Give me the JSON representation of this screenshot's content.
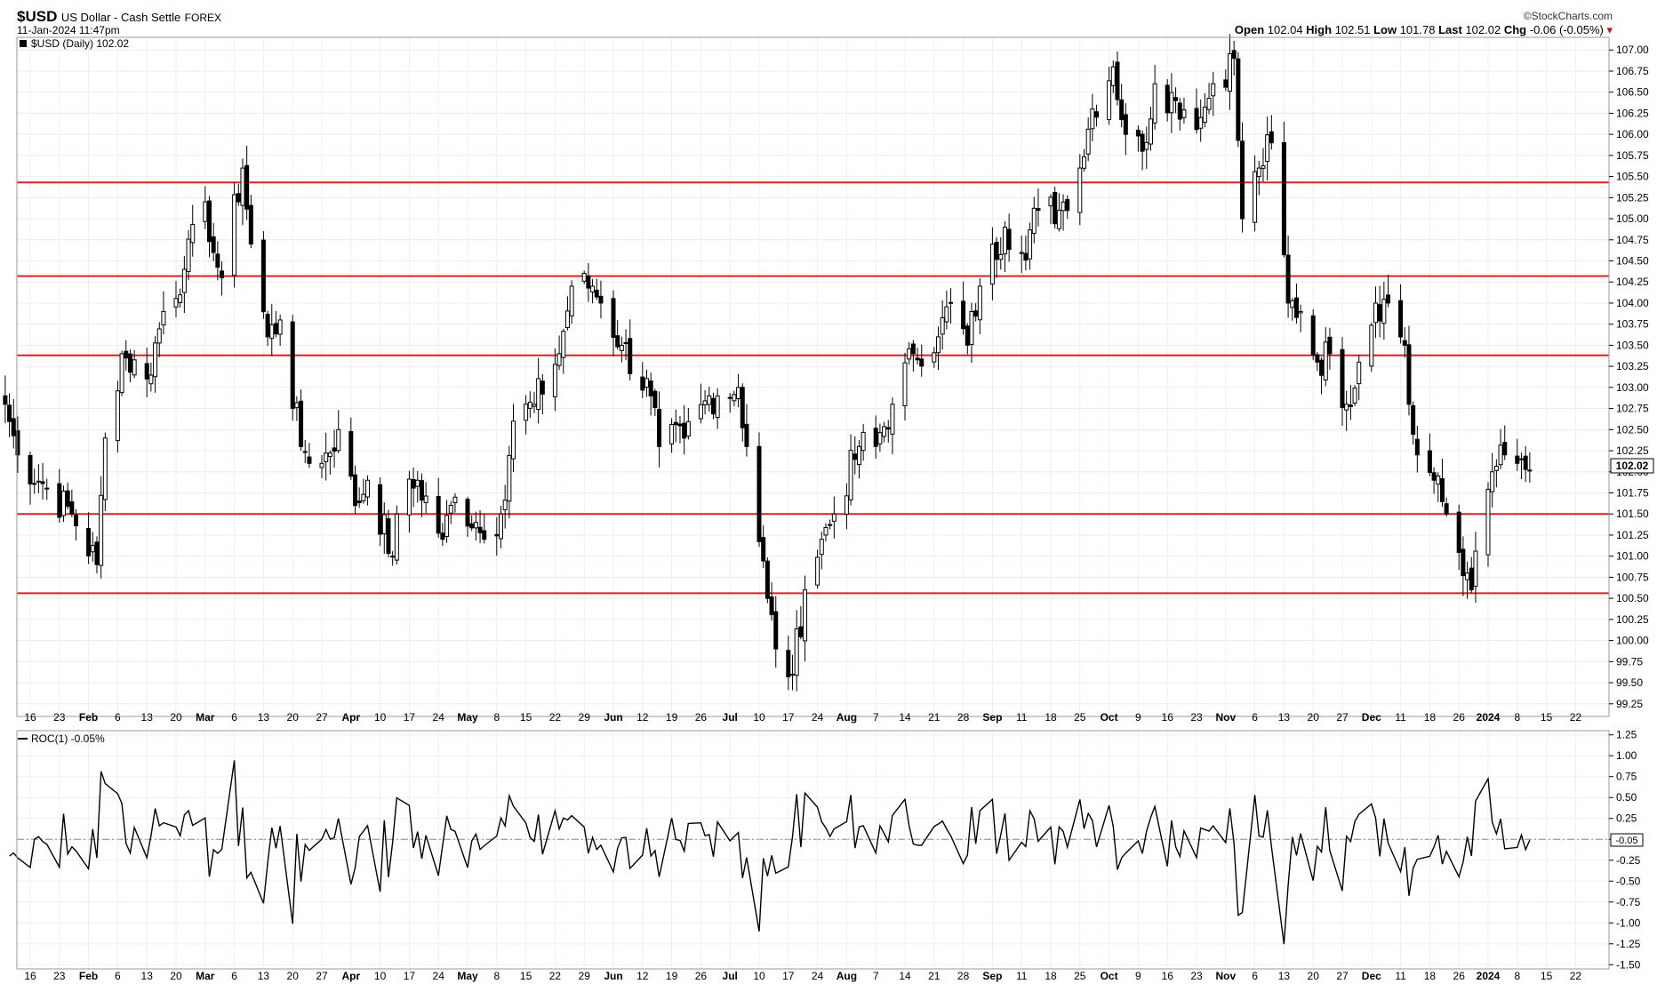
{
  "header": {
    "symbol": "$USD",
    "name": "US Dollar - Cash Settle",
    "exchange": "FOREX",
    "datetime": "11-Jan-2024 11:47pm",
    "brand": "©StockCharts.com",
    "open_label": "Open",
    "open": "102.04",
    "high_label": "High",
    "high": "102.51",
    "low_label": "Low",
    "low": "101.78",
    "last_label": "Last",
    "last": "102.02",
    "chg_label": "Chg",
    "chg": "-0.06 (-0.05%)"
  },
  "colors": {
    "resistance_line": "#e02020",
    "support_line": "#1a8a1a",
    "candle": "#000000",
    "roc_line": "#000000"
  },
  "chart_data": [
    {
      "type": "candlestick",
      "title": "$USD (Daily) 102.02",
      "last_value_label": "102.02",
      "ylim": [
        99.1,
        107.15
      ],
      "y_ticks": [
        "107.00",
        "106.75",
        "106.50",
        "106.25",
        "106.00",
        "105.75",
        "105.50",
        "105.25",
        "105.00",
        "104.75",
        "104.50",
        "104.25",
        "104.00",
        "103.75",
        "103.50",
        "103.25",
        "103.00",
        "102.75",
        "102.50",
        "102.25",
        "102.00",
        "101.75",
        "101.50",
        "101.25",
        "101.00",
        "100.75",
        "100.50",
        "100.25",
        "100.00",
        "99.75",
        "99.50",
        "99.25"
      ],
      "x_ticks": [
        {
          "label": "16",
          "bold": false
        },
        {
          "label": "23",
          "bold": false
        },
        {
          "label": "Feb",
          "bold": true
        },
        {
          "label": "6",
          "bold": false
        },
        {
          "label": "13",
          "bold": false
        },
        {
          "label": "20",
          "bold": false
        },
        {
          "label": "Mar",
          "bold": true
        },
        {
          "label": "6",
          "bold": false
        },
        {
          "label": "13",
          "bold": false
        },
        {
          "label": "20",
          "bold": false
        },
        {
          "label": "27",
          "bold": false
        },
        {
          "label": "Apr",
          "bold": true
        },
        {
          "label": "10",
          "bold": false
        },
        {
          "label": "17",
          "bold": false
        },
        {
          "label": "24",
          "bold": false
        },
        {
          "label": "May",
          "bold": true
        },
        {
          "label": "8",
          "bold": false
        },
        {
          "label": "15",
          "bold": false
        },
        {
          "label": "22",
          "bold": false
        },
        {
          "label": "29",
          "bold": false
        },
        {
          "label": "Jun",
          "bold": true
        },
        {
          "label": "12",
          "bold": false
        },
        {
          "label": "19",
          "bold": false
        },
        {
          "label": "26",
          "bold": false
        },
        {
          "label": "Jul",
          "bold": true
        },
        {
          "label": "10",
          "bold": false
        },
        {
          "label": "17",
          "bold": false
        },
        {
          "label": "24",
          "bold": false
        },
        {
          "label": "Aug",
          "bold": true
        },
        {
          "label": "7",
          "bold": false
        },
        {
          "label": "14",
          "bold": false
        },
        {
          "label": "21",
          "bold": false
        },
        {
          "label": "28",
          "bold": false
        },
        {
          "label": "Sep",
          "bold": true
        },
        {
          "label": "11",
          "bold": false
        },
        {
          "label": "18",
          "bold": false
        },
        {
          "label": "25",
          "bold": false
        },
        {
          "label": "Oct",
          "bold": true
        },
        {
          "label": "9",
          "bold": false
        },
        {
          "label": "16",
          "bold": false
        },
        {
          "label": "23",
          "bold": false
        },
        {
          "label": "Nov",
          "bold": true
        },
        {
          "label": "6",
          "bold": false
        },
        {
          "label": "13",
          "bold": false
        },
        {
          "label": "20",
          "bold": false
        },
        {
          "label": "27",
          "bold": false
        },
        {
          "label": "Dec",
          "bold": true
        },
        {
          "label": "11",
          "bold": false
        },
        {
          "label": "18",
          "bold": false
        },
        {
          "label": "26",
          "bold": false
        },
        {
          "label": "2024",
          "bold": true
        },
        {
          "label": "8",
          "bold": false
        },
        {
          "label": "15",
          "bold": false
        },
        {
          "label": "22",
          "bold": false
        }
      ],
      "horizontal_levels": [
        105.43,
        104.32,
        103.38,
        101.5,
        100.56
      ],
      "keypoints": [
        {
          "date": "2023-01-10",
          "close": 102.8
        },
        {
          "date": "2023-01-13",
          "close": 102.2
        },
        {
          "date": "2023-01-20",
          "close": 101.8
        },
        {
          "date": "2023-01-26",
          "close": 101.5
        },
        {
          "date": "2023-02-01",
          "close": 100.9
        },
        {
          "date": "2023-02-03",
          "close": 102.4
        },
        {
          "date": "2023-02-07",
          "close": 103.4
        },
        {
          "date": "2023-02-13",
          "close": 103.1
        },
        {
          "date": "2023-02-17",
          "close": 103.9
        },
        {
          "date": "2023-02-22",
          "close": 104.4
        },
        {
          "date": "2023-02-27",
          "close": 105.2
        },
        {
          "date": "2023-03-01",
          "close": 104.6
        },
        {
          "date": "2023-03-03",
          "close": 104.3
        },
        {
          "date": "2023-03-08",
          "close": 105.6
        },
        {
          "date": "2023-03-10",
          "close": 104.7
        },
        {
          "date": "2023-03-14",
          "close": 103.6
        },
        {
          "date": "2023-03-17",
          "close": 103.8
        },
        {
          "date": "2023-03-22",
          "close": 102.3
        },
        {
          "date": "2023-03-27",
          "close": 102.1
        },
        {
          "date": "2023-03-31",
          "close": 102.5
        },
        {
          "date": "2023-04-04",
          "close": 101.6
        },
        {
          "date": "2023-04-07",
          "close": 101.9
        },
        {
          "date": "2023-04-13",
          "close": 101.0
        },
        {
          "date": "2023-04-14",
          "close": 101.5
        },
        {
          "date": "2023-04-19",
          "close": 101.9
        },
        {
          "date": "2023-04-25",
          "close": 101.2
        },
        {
          "date": "2023-04-28",
          "close": 101.7
        },
        {
          "date": "2023-05-03",
          "close": 101.4
        },
        {
          "date": "2023-05-05",
          "close": 101.2
        },
        {
          "date": "2023-05-09",
          "close": 101.5
        },
        {
          "date": "2023-05-12",
          "close": 102.6
        },
        {
          "date": "2023-05-17",
          "close": 102.8
        },
        {
          "date": "2023-05-23",
          "close": 103.4
        },
        {
          "date": "2023-05-26",
          "close": 104.2
        },
        {
          "date": "2023-05-31",
          "close": 104.2
        },
        {
          "date": "2023-06-02",
          "close": 104.0
        },
        {
          "date": "2023-06-07",
          "close": 103.5
        },
        {
          "date": "2023-06-14",
          "close": 102.9
        },
        {
          "date": "2023-06-16",
          "close": 102.3
        },
        {
          "date": "2023-06-22",
          "close": 102.4
        },
        {
          "date": "2023-06-28",
          "close": 102.9
        },
        {
          "date": "2023-06-30",
          "close": 102.9
        },
        {
          "date": "2023-07-05",
          "close": 103.0
        },
        {
          "date": "2023-07-07",
          "close": 102.3
        },
        {
          "date": "2023-07-12",
          "close": 100.5
        },
        {
          "date": "2023-07-14",
          "close": 99.9
        },
        {
          "date": "2023-07-18",
          "close": 99.6
        },
        {
          "date": "2023-07-21",
          "close": 100.6
        },
        {
          "date": "2023-07-25",
          "close": 101.2
        },
        {
          "date": "2023-07-28",
          "close": 101.5
        },
        {
          "date": "2023-08-03",
          "close": 102.3
        },
        {
          "date": "2023-08-07",
          "close": 102.3
        },
        {
          "date": "2023-08-11",
          "close": 102.8
        },
        {
          "date": "2023-08-16",
          "close": 103.4
        },
        {
          "date": "2023-08-22",
          "close": 103.6
        },
        {
          "date": "2023-08-25",
          "close": 104.0
        },
        {
          "date": "2023-08-29",
          "close": 103.5
        },
        {
          "date": "2023-09-01",
          "close": 104.2
        },
        {
          "date": "2023-09-07",
          "close": 104.9
        },
        {
          "date": "2023-09-11",
          "close": 104.6
        },
        {
          "date": "2023-09-15",
          "close": 105.1
        },
        {
          "date": "2023-09-20",
          "close": 105.1
        },
        {
          "date": "2023-09-25",
          "close": 105.6
        },
        {
          "date": "2023-09-28",
          "close": 106.3
        },
        {
          "date": "2023-10-03",
          "close": 106.8
        },
        {
          "date": "2023-10-06",
          "close": 106.0
        },
        {
          "date": "2023-10-10",
          "close": 105.8
        },
        {
          "date": "2023-10-13",
          "close": 106.6
        },
        {
          "date": "2023-10-18",
          "close": 106.4
        },
        {
          "date": "2023-10-24",
          "close": 106.2
        },
        {
          "date": "2023-10-27",
          "close": 106.6
        },
        {
          "date": "2023-11-01",
          "close": 106.9
        },
        {
          "date": "2023-11-03",
          "close": 105.0
        },
        {
          "date": "2023-11-07",
          "close": 105.6
        },
        {
          "date": "2023-11-10",
          "close": 105.9
        },
        {
          "date": "2023-11-14",
          "close": 104.0
        },
        {
          "date": "2023-11-17",
          "close": 103.9
        },
        {
          "date": "2023-11-21",
          "close": 103.3
        },
        {
          "date": "2023-11-24",
          "close": 103.4
        },
        {
          "date": "2023-11-28",
          "close": 102.8
        },
        {
          "date": "2023-12-01",
          "close": 103.3
        },
        {
          "date": "2023-12-05",
          "close": 104.0
        },
        {
          "date": "2023-12-08",
          "close": 104.0
        },
        {
          "date": "2023-12-12",
          "close": 103.5
        },
        {
          "date": "2023-12-13",
          "close": 102.8
        },
        {
          "date": "2023-12-15",
          "close": 102.2
        },
        {
          "date": "2023-12-19",
          "close": 101.9
        },
        {
          "date": "2023-12-22",
          "close": 101.5
        },
        {
          "date": "2023-12-27",
          "close": 100.8
        },
        {
          "date": "2023-12-28",
          "close": 100.6
        },
        {
          "date": "2024-01-02",
          "close": 102.0
        },
        {
          "date": "2024-01-05",
          "close": 102.2
        },
        {
          "date": "2024-01-08",
          "close": 102.1
        },
        {
          "date": "2024-01-11",
          "close": 102.02
        }
      ]
    },
    {
      "type": "line",
      "title": "ROC(1) -0.05%",
      "last_value_label": "-0.05",
      "ylim": [
        -1.55,
        1.3
      ],
      "y_ticks": [
        "1.25",
        "1.00",
        "0.75",
        "0.50",
        "0.25",
        "0.00",
        "-0.25",
        "-0.50",
        "-0.75",
        "-1.00",
        "-1.25",
        "-1.50"
      ],
      "zero_line": true
    }
  ]
}
